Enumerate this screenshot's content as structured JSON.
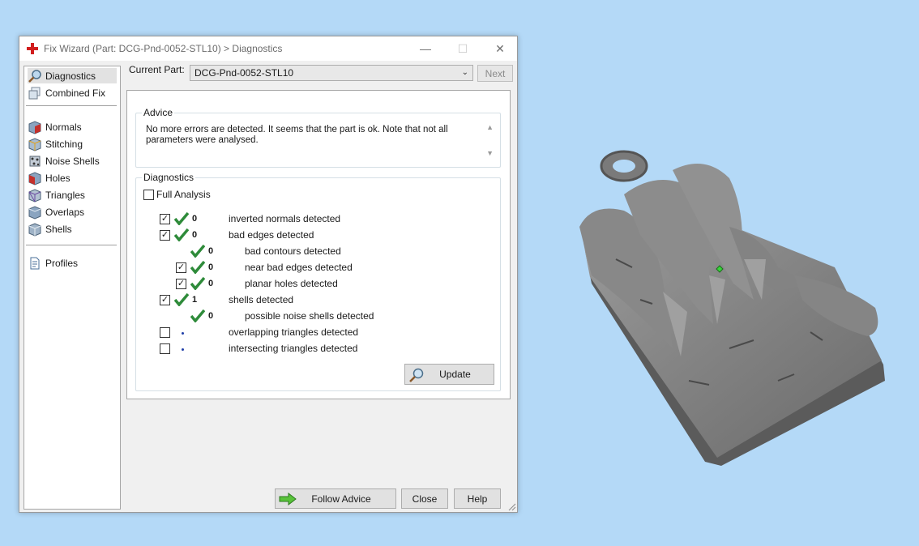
{
  "window": {
    "title": "Fix Wizard (Part: DCG-Pnd-0052-STL10) > Diagnostics",
    "minimize": "—",
    "maximize": "☐",
    "close": "✕"
  },
  "sidebar": {
    "items": [
      {
        "label": "Diagnostics",
        "icon": "magnifier-icon"
      },
      {
        "label": "Combined Fix",
        "icon": "cubes-icon"
      },
      {
        "label": "Normals",
        "icon": "normals-cube-icon"
      },
      {
        "label": "Stitching",
        "icon": "stitching-cube-icon"
      },
      {
        "label": "Noise Shells",
        "icon": "noise-shells-icon"
      },
      {
        "label": "Holes",
        "icon": "holes-cube-icon"
      },
      {
        "label": "Triangles",
        "icon": "triangles-cube-icon"
      },
      {
        "label": "Overlaps",
        "icon": "overlaps-cube-icon"
      },
      {
        "label": "Shells",
        "icon": "shells-cube-icon"
      },
      {
        "label": "Profiles",
        "icon": "document-icon"
      }
    ]
  },
  "header": {
    "current_part_label": "Current Part:",
    "current_part_value": "DCG-Pnd-0052-STL10",
    "next_label": "Next"
  },
  "advice": {
    "title": "Advice",
    "text": "No more errors are detected. It seems that the part is ok. Note that not all parameters were analysed."
  },
  "diagnostics": {
    "title": "Diagnostics",
    "full_analysis_label": "Full Analysis",
    "rows": [
      {
        "count": "0",
        "label": "inverted normals detected"
      },
      {
        "count": "0",
        "label": "bad edges detected"
      },
      {
        "count": "0",
        "label": "bad contours detected"
      },
      {
        "count": "0",
        "label": "near bad edges detected"
      },
      {
        "count": "0",
        "label": "planar holes detected"
      },
      {
        "count": "1",
        "label": "shells detected"
      },
      {
        "count": "0",
        "label": "possible noise shells detected"
      },
      {
        "count": "",
        "label": "overlapping triangles detected"
      },
      {
        "count": "",
        "label": "intersecting triangles detected"
      }
    ],
    "update_label": "Update"
  },
  "footer": {
    "follow_advice_label": "Follow Advice",
    "close_label": "Close",
    "help_label": "Help"
  },
  "colors": {
    "desktop": "#b4d9f7",
    "check_green": "#2e8b3a",
    "model_gray": "#7d7d7d"
  }
}
